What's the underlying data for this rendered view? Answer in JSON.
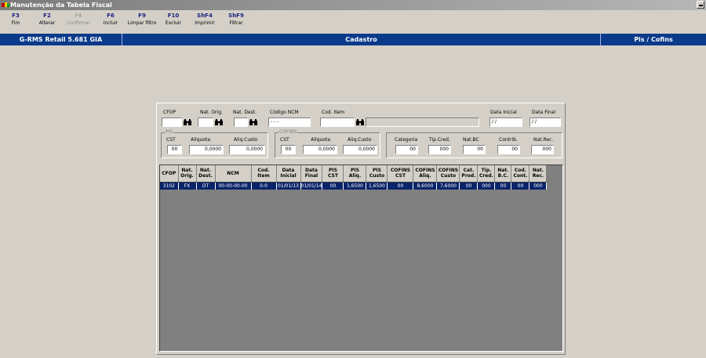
{
  "window": {
    "title": "Manutenção da Tabela Fiscal"
  },
  "function_keys": [
    {
      "key": "F3",
      "label": "Fim",
      "enabled": true
    },
    {
      "key": "F2",
      "label": "Alterar",
      "enabled": true
    },
    {
      "key": "F4",
      "label": "Confirmar",
      "enabled": false
    },
    {
      "key": "F6",
      "label": "Incluir",
      "enabled": true
    },
    {
      "key": "F9",
      "label": "Limpar filtro",
      "enabled": true
    },
    {
      "key": "F10",
      "label": "Excluir",
      "enabled": true
    },
    {
      "key": "ShF4",
      "label": "Imprimir",
      "enabled": true
    },
    {
      "key": "ShF9",
      "label": "Filtrar",
      "enabled": true
    }
  ],
  "header_bar": {
    "system": "G-RMS Retail 5.681 GIA",
    "module": "Cadastro",
    "screen": "Pis / Cofins",
    "color": "#0a3a8a"
  },
  "filters": {
    "cfop": {
      "label": "CFOP",
      "value": ""
    },
    "nat_orig": {
      "label": "Nat. Orig.",
      "value": ""
    },
    "nat_dest": {
      "label": "Nat. Dest.",
      "value": ""
    },
    "codigo_ncm": {
      "label": "Código NCM",
      "value": "- - -"
    },
    "cod_item": {
      "label": "Cod. Item",
      "value": "",
      "description": ""
    },
    "data_inicial": {
      "label": "Data Inicial",
      "value": "/ /"
    },
    "data_final": {
      "label": "Data Final",
      "value": "/ /"
    },
    "pis": {
      "title": "PIS",
      "cst": {
        "label": "CST",
        "value": "00"
      },
      "aliquota": {
        "label": "Aliquota",
        "value": "0,0000"
      },
      "aliq_custo": {
        "label": "Aliq.Custo",
        "value": "0,0000"
      }
    },
    "cofins": {
      "title": "COFINS",
      "cst": {
        "label": "CST",
        "value": "00"
      },
      "aliquota": {
        "label": "Aliquota",
        "value": "0,0000"
      },
      "aliq_custo": {
        "label": "Aliq.Custo",
        "value": "0,0000"
      }
    },
    "categoria": {
      "label": "Categoria",
      "value": "00"
    },
    "tip_cred": {
      "label": "Tip.Cred.",
      "value": "000"
    },
    "nat_bc": {
      "label": "Nat.BC",
      "value": "00"
    },
    "contrib": {
      "label": "Contrib.",
      "value": "00"
    },
    "nat_rec": {
      "label": "Nat.Rec.",
      "value": "000"
    }
  },
  "table": {
    "columns": [
      "CFOP",
      "Nat.\nOrig.",
      "Nat.\nDest.",
      "NCM",
      "Cod.\nItem",
      "Data\nInicial",
      "Data\nFinal",
      "PIS\nCST",
      "PIS\nAliq.",
      "PIS\nCusto",
      "COFINS\nCST",
      "COFINS\nAliq.",
      "COFINS\nCusto",
      "Cat.\nProd.",
      "Tip.\nCred.",
      "Nat.\nB.C.",
      "Cod.\nCont.",
      "Nat.\nRec."
    ],
    "rows": [
      [
        "3102",
        "FX",
        "DT",
        "00-00-00-00",
        "0-0",
        "01/01/13",
        "01/01/14",
        "00",
        "1,6500",
        "1,6500",
        "00",
        "8,6000",
        "7,6000",
        "00",
        "000",
        "00",
        "00",
        "000"
      ]
    ],
    "selected_row_color": "#0a246a"
  },
  "icons": {
    "filter_lookup": "binoculars-icon"
  }
}
